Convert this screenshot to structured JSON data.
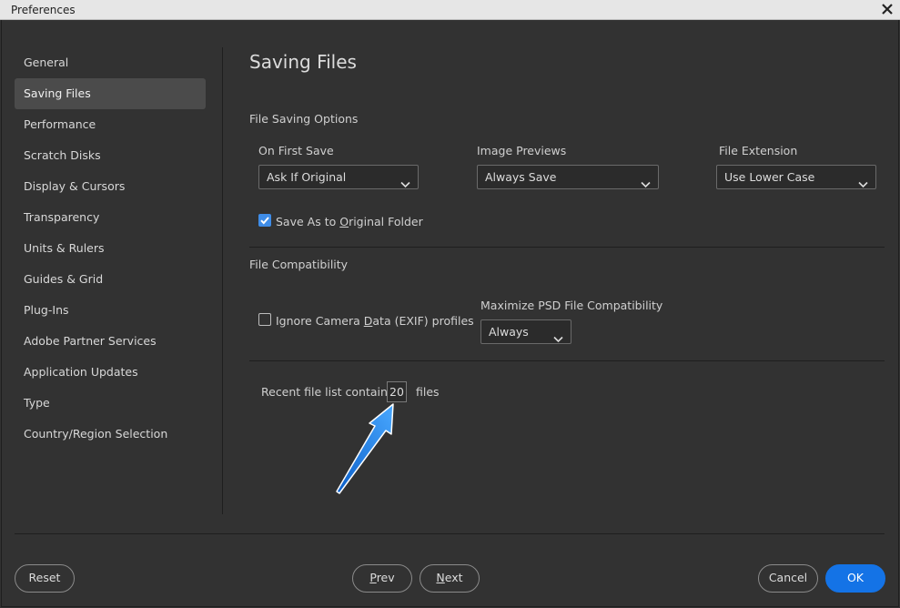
{
  "window": {
    "title": "Preferences"
  },
  "sidebar": {
    "items": [
      {
        "label": "General"
      },
      {
        "label": "Saving Files",
        "active": true
      },
      {
        "label": "Performance"
      },
      {
        "label": "Scratch Disks"
      },
      {
        "label": "Display & Cursors"
      },
      {
        "label": "Transparency"
      },
      {
        "label": "Units & Rulers"
      },
      {
        "label": "Guides & Grid"
      },
      {
        "label": "Plug-Ins"
      },
      {
        "label": "Adobe Partner Services"
      },
      {
        "label": "Application Updates"
      },
      {
        "label": "Type"
      },
      {
        "label": "Country/Region Selection"
      }
    ]
  },
  "main": {
    "heading": "Saving Files",
    "file_saving": {
      "section_label": "File Saving Options",
      "on_first_save": {
        "label": "On First Save",
        "value": "Ask If Original"
      },
      "image_previews": {
        "label": "Image Previews",
        "value": "Always Save"
      },
      "file_extension": {
        "label": "File Extension",
        "value": "Use Lower Case"
      },
      "save_as_original": {
        "label_pre": "Save As to ",
        "label_u": "O",
        "label_post": "riginal Folder",
        "checked": true
      }
    },
    "file_compat": {
      "section_label": "File Compatibility",
      "ignore_exif": {
        "label_pre": "Ignore Camera ",
        "label_u": "D",
        "label_post": "ata (EXIF) profiles",
        "checked": false
      },
      "maximize_psd": {
        "label": "Maximize PSD File Compatibility",
        "value": "Always"
      }
    },
    "recent": {
      "prefix": "Recent file list contains",
      "value": "20",
      "suffix": "files"
    }
  },
  "footer": {
    "reset": "Reset",
    "prev_u": "P",
    "prev_rest": "rev",
    "next_u": "N",
    "next_rest": "ext",
    "cancel": "Cancel",
    "ok": "OK"
  },
  "colors": {
    "accent": "#1473e6",
    "checkbox": "#3f8de8",
    "arrow": "#1e88e5"
  }
}
